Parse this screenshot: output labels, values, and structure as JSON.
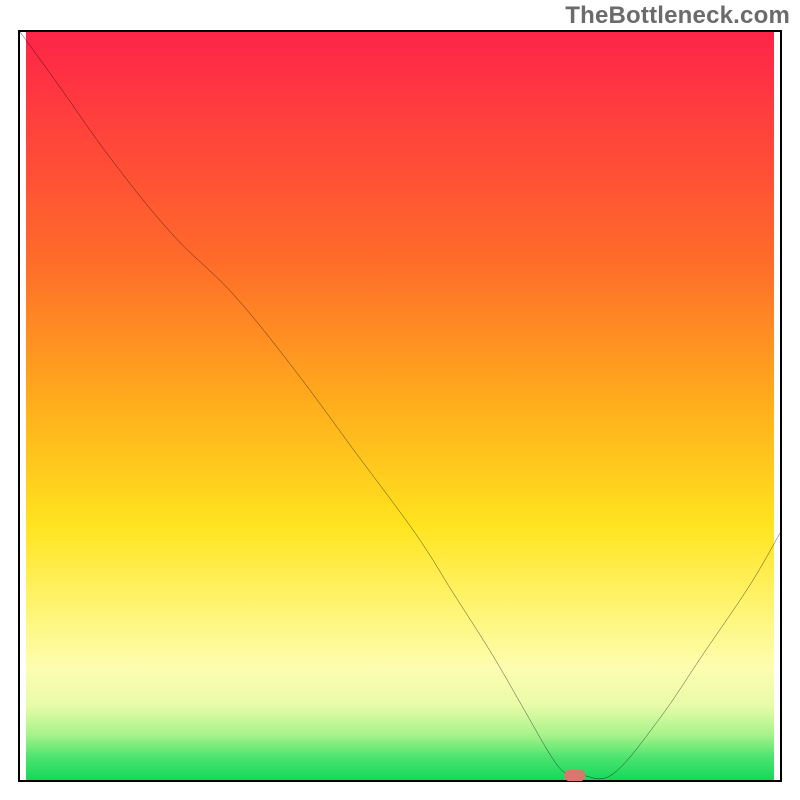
{
  "watermark": "TheBottleneck.com",
  "chart_data": {
    "type": "line",
    "title": "",
    "xlabel": "",
    "ylabel": "",
    "xlim": [
      0,
      100
    ],
    "ylim": [
      0,
      100
    ],
    "grid": false,
    "legend": false,
    "series": [
      {
        "name": "bottleneck-curve",
        "x": [
          0,
          5,
          12,
          20,
          28,
          36,
          44,
          52,
          57,
          62,
          66,
          70,
          72,
          74,
          78,
          84,
          90,
          96,
          100
        ],
        "values": [
          100,
          93,
          83,
          73,
          65,
          55,
          44,
          33,
          25,
          17,
          10,
          3,
          0.8,
          0.6,
          0.8,
          8,
          17,
          26,
          33
        ]
      }
    ],
    "marker": {
      "name": "target-point",
      "x": 73,
      "y": 0.6,
      "shape": "pill",
      "color": "#d7776d"
    },
    "background_gradient": {
      "stops": [
        {
          "pos": 0,
          "color": "#fd2448"
        },
        {
          "pos": 50,
          "color": "#ffae1c"
        },
        {
          "pos": 78,
          "color": "#fff67a"
        },
        {
          "pos": 100,
          "color": "#15d85c"
        }
      ]
    }
  }
}
